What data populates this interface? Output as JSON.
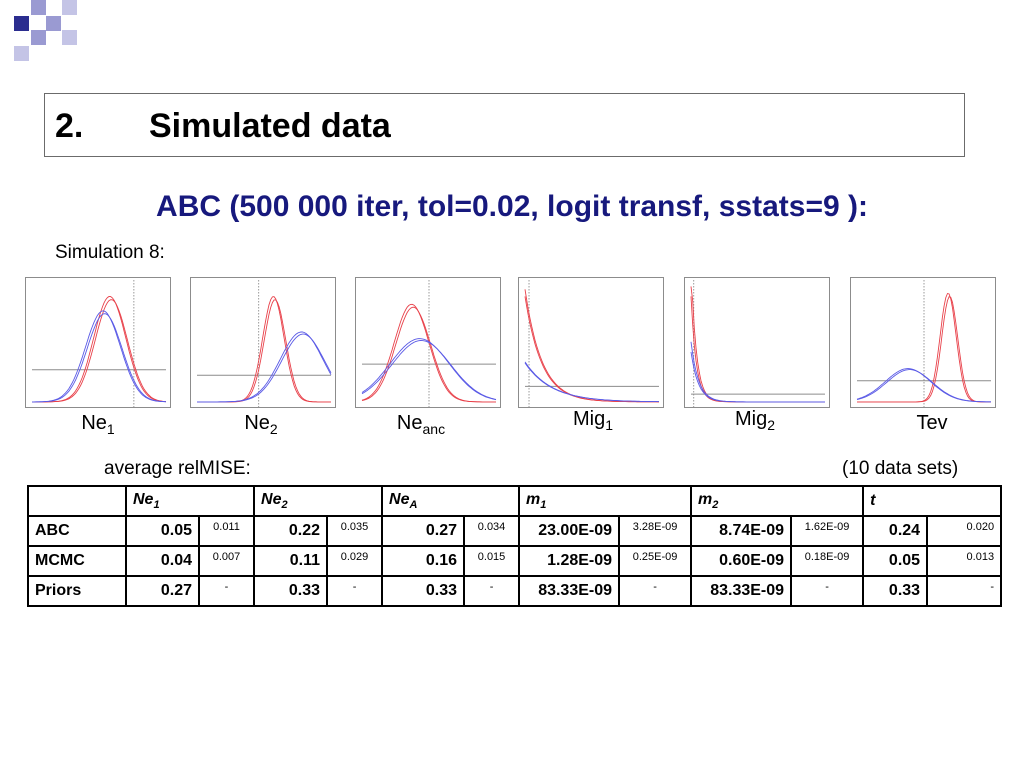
{
  "slide": {
    "section_number": "2.",
    "section_title": "Simulated data",
    "subtitle": "ABC (500 000 iter, tol=0.02, logit transf, sstats=9 ):",
    "simulation_label": "Simulation 8:",
    "avg_label": "average relMISE:",
    "datasets_label": "(10 data sets)"
  },
  "colors": {
    "accent_dark": "#2b2d8f",
    "accent_light": "#9a9ad2",
    "subtitle": "#17197d",
    "abc_curve": "#e8414a",
    "mcmc_curve": "#5a5ae6",
    "prior_line": "#8c8c8c"
  },
  "panel_labels": [
    {
      "base": "Ne",
      "sub": "1"
    },
    {
      "base": "Ne",
      "sub": "2"
    },
    {
      "base": "Ne",
      "sub": "anc"
    },
    {
      "base": "Mig",
      "sub": "1"
    },
    {
      "base": "Mig",
      "sub": "2"
    },
    {
      "base": "Tev",
      "sub": ""
    }
  ],
  "table": {
    "headers": [
      {
        "base": "Ne",
        "sub": "1"
      },
      {
        "base": "Ne",
        "sub": "2"
      },
      {
        "base": "Ne",
        "sub": "A"
      },
      {
        "base": "m",
        "sub": "1"
      },
      {
        "base": "m",
        "sub": "2"
      },
      {
        "base": "t",
        "sub": ""
      }
    ],
    "rows": [
      {
        "label": "ABC",
        "cells": [
          [
            "0.05",
            "0.011"
          ],
          [
            "0.22",
            "0.035"
          ],
          [
            "0.27",
            "0.034"
          ],
          [
            "23.00E-09",
            "3.28E-09"
          ],
          [
            "8.74E-09",
            "1.62E-09"
          ],
          [
            "0.24",
            "0.020"
          ]
        ]
      },
      {
        "label": "MCMC",
        "cells": [
          [
            "0.04",
            "0.007"
          ],
          [
            "0.11",
            "0.029"
          ],
          [
            "0.16",
            "0.015"
          ],
          [
            "1.28E-09",
            "0.25E-09"
          ],
          [
            "0.60E-09",
            "0.18E-09"
          ],
          [
            "0.05",
            "0.013"
          ]
        ]
      },
      {
        "label": "Priors",
        "cells": [
          [
            "0.27",
            "-"
          ],
          [
            "0.33",
            "-"
          ],
          [
            "0.33",
            "-"
          ],
          [
            "83.33E-09",
            "-"
          ],
          [
            "83.33E-09",
            "-"
          ],
          [
            "0.33",
            "-"
          ]
        ]
      }
    ]
  },
  "chart_data": [
    {
      "type": "line",
      "label": "Ne1",
      "x_range": [
        0,
        1
      ],
      "y_range": [
        0,
        1
      ],
      "true_value": 0.76,
      "prior": 0.3,
      "series": [
        {
          "kind": "abc",
          "peaks": [
            {
              "mu": 0.58,
              "sd": 0.12,
              "h": 0.95
            }
          ]
        },
        {
          "kind": "mcmc",
          "peaks": [
            {
              "mu": 0.53,
              "sd": 0.13,
              "h": 0.82
            }
          ]
        }
      ]
    },
    {
      "type": "line",
      "label": "Ne2",
      "x_range": [
        0,
        1
      ],
      "y_range": [
        0,
        1
      ],
      "true_value": 0.46,
      "prior": 0.25,
      "series": [
        {
          "kind": "abc",
          "peaks": [
            {
              "mu": 0.57,
              "sd": 0.08,
              "h": 0.95
            }
          ]
        },
        {
          "kind": "mcmc",
          "peaks": [
            {
              "mu": 0.78,
              "sd": 0.16,
              "h": 0.63
            }
          ]
        }
      ]
    },
    {
      "type": "line",
      "label": "Neanc",
      "x_range": [
        0,
        1
      ],
      "y_range": [
        0,
        1
      ],
      "true_value": 0.5,
      "prior": 0.35,
      "series": [
        {
          "kind": "abc",
          "peaks": [
            {
              "mu": 0.37,
              "sd": 0.13,
              "h": 0.88
            }
          ]
        },
        {
          "kind": "mcmc",
          "peaks": [
            {
              "mu": 0.43,
              "sd": 0.22,
              "h": 0.57
            }
          ]
        }
      ]
    },
    {
      "type": "line",
      "label": "Mig1",
      "x_range": [
        0,
        1
      ],
      "y_range": [
        0,
        1
      ],
      "true_value": 0.03,
      "prior": 0.15,
      "series": [
        {
          "kind": "abc",
          "decay": {
            "h": 0.95,
            "rate": 8
          }
        },
        {
          "kind": "mcmc",
          "decay": {
            "h": 0.35,
            "rate": 5
          }
        }
      ]
    },
    {
      "type": "line",
      "label": "Mig2",
      "x_range": [
        0,
        1
      ],
      "y_range": [
        0,
        1
      ],
      "true_value": 0.02,
      "prior": 0.08,
      "series": [
        {
          "kind": "abc",
          "decay": {
            "h": 0.95,
            "rate": 25
          }
        },
        {
          "kind": "mcmc",
          "decay": {
            "h": 0.45,
            "rate": 18
          }
        }
      ]
    },
    {
      "type": "line",
      "label": "Tev",
      "x_range": [
        0,
        1
      ],
      "y_range": [
        0,
        1
      ],
      "true_value": 0.5,
      "prior": 0.2,
      "series": [
        {
          "kind": "abc",
          "peaks": [
            {
              "mu": 0.68,
              "sd": 0.06,
              "h": 0.98
            }
          ]
        },
        {
          "kind": "mcmc",
          "peaks": [
            {
              "mu": 0.38,
              "sd": 0.17,
              "h": 0.3
            }
          ]
        }
      ]
    }
  ]
}
